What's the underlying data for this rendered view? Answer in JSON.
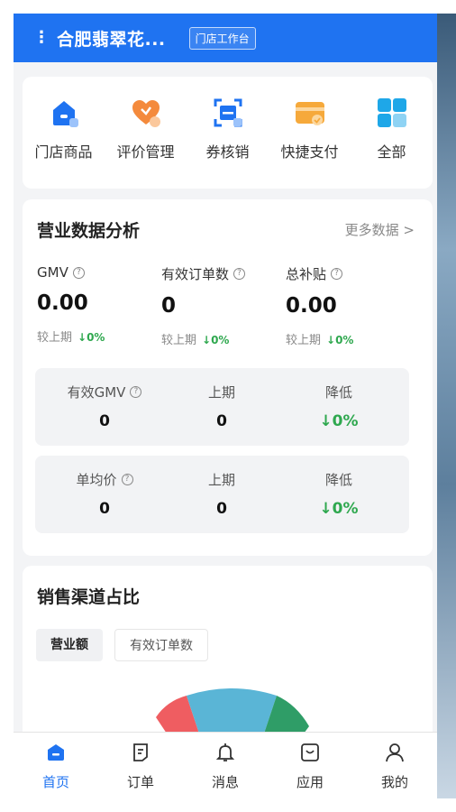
{
  "header": {
    "store_name": "合肥翡翠花...",
    "tag": "门店工作台"
  },
  "quick_actions": [
    {
      "label": "门店商品",
      "icon": "store-icon"
    },
    {
      "label": "评价管理",
      "icon": "heart-icon"
    },
    {
      "label": "券核销",
      "icon": "scan-icon"
    },
    {
      "label": "快捷支付",
      "icon": "card-icon"
    },
    {
      "label": "全部",
      "icon": "grid-icon"
    }
  ],
  "stats": {
    "title": "营业数据分析",
    "more": "更多数据 >",
    "metrics": [
      {
        "label": "GMV",
        "value": "0.00",
        "compare_label": "较上期",
        "change": "↓0%"
      },
      {
        "label": "有效订单数",
        "value": "0",
        "compare_label": "较上期",
        "change": "↓0%"
      },
      {
        "label": "总补贴",
        "value": "0.00",
        "compare_label": "较上期",
        "change": "↓0%"
      }
    ],
    "rows": [
      {
        "label": "有效GMV",
        "current": "0",
        "prev_label": "上期",
        "prev": "0",
        "delta_label": "降低",
        "delta": "↓0%"
      },
      {
        "label": "单均价",
        "current": "0",
        "prev_label": "上期",
        "prev": "0",
        "delta_label": "降低",
        "delta": "↓0%"
      }
    ]
  },
  "channel": {
    "title": "销售渠道占比",
    "tabs": [
      "营业额",
      "有效订单数"
    ]
  },
  "tabbar": [
    {
      "label": "首页",
      "icon": "home-icon"
    },
    {
      "label": "订单",
      "icon": "order-icon"
    },
    {
      "label": "消息",
      "icon": "bell-icon"
    },
    {
      "label": "应用",
      "icon": "apps-icon"
    },
    {
      "label": "我的",
      "icon": "profile-icon"
    }
  ],
  "colors": {
    "brand": "#1f73f1",
    "down": "#2fa84f",
    "pie_red": "#ef5d61",
    "pie_blue": "#5ab5d6",
    "pie_green": "#2f9d67"
  }
}
